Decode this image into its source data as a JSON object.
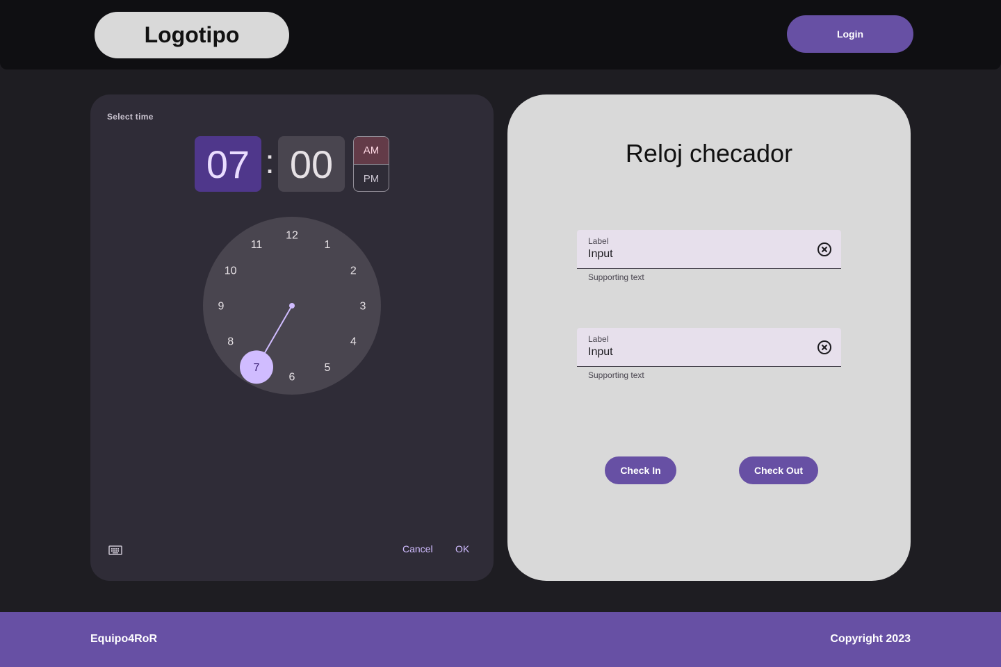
{
  "header": {
    "logo_text": "Logotipo",
    "login_label": "Login"
  },
  "time_picker": {
    "title": "Select time",
    "hour": "07",
    "separator": ":",
    "minute": "00",
    "am_label": "AM",
    "pm_label": "PM",
    "selected_period": "AM",
    "clock_numbers": [
      "12",
      "1",
      "2",
      "3",
      "4",
      "5",
      "6",
      "7",
      "8",
      "9",
      "10",
      "11"
    ],
    "selected_number": "7",
    "keyboard_icon": "keyboard-icon",
    "cancel_label": "Cancel",
    "ok_label": "OK"
  },
  "card": {
    "title": "Reloj checador",
    "fields": [
      {
        "label": "Label",
        "value": "Input",
        "supporting_text": "Supporting text",
        "clear_icon": "cancel-circle-icon"
      },
      {
        "label": "Label",
        "value": "Input",
        "supporting_text": "Supporting text",
        "clear_icon": "cancel-circle-icon"
      }
    ],
    "check_in_label": "Check In",
    "check_out_label": "Check Out"
  },
  "footer": {
    "team": "Equipo4RoR",
    "copyright": "Copyright 2023"
  },
  "colors": {
    "primary": "#6750a4",
    "background": "#1e1d22",
    "header_bg": "#0f0f12",
    "card_bg": "#d9d9d9",
    "picker_bg": "#2f2c37",
    "selected_hour_bg": "#4f378b",
    "am_selected_bg": "#633b48",
    "clock_face": "#49454f",
    "clock_selector": "#d0bcff"
  }
}
